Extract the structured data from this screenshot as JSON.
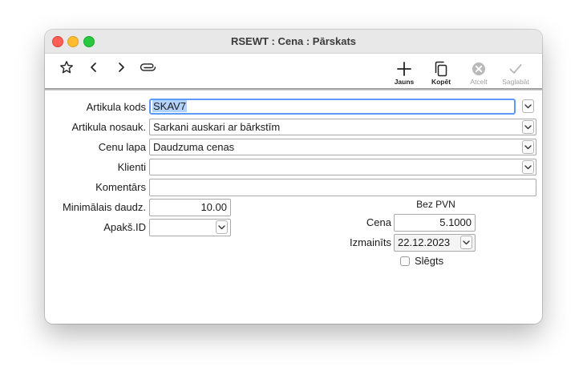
{
  "window": {
    "title": "RSEWT : Cena : Pārskats"
  },
  "toolbar": {
    "icons": [
      "star-icon",
      "chevron-left-icon",
      "chevron-right-icon",
      "paperclip-icon"
    ],
    "new_label": "Jauns",
    "copy_label": "Kopēt",
    "cancel_label": "Atcelt",
    "save_label": "Saglabāt"
  },
  "form": {
    "item_code_label": "Artikula kods",
    "item_code_value": "SKAV7",
    "item_name_label": "Artikula nosauk.",
    "item_name_value": "Sarkani auskari ar bārkstīm",
    "price_list_label": "Cenu lapa",
    "price_list_value": "Daudzuma cenas",
    "client_label": "Klienti",
    "client_value": "",
    "comment_label": "Komentārs",
    "comment_value": "",
    "min_qty_label": "Minimālais daudz.",
    "min_qty_value": "10.00",
    "subid_label": "Apakš.ID",
    "subid_value": "",
    "vat_header": "Bez PVN",
    "price_label": "Cena",
    "price_value": "5.1000",
    "changed_label": "Izmainīts",
    "changed_value": "22.12.2023",
    "closed_label": "Slēgts",
    "closed_checked": false
  },
  "colors": {
    "selection": "#b3d3fb",
    "focus_ring": "#5b9af5",
    "close": "#fe5f57",
    "minimize": "#febc2e",
    "maximize": "#28c840"
  }
}
